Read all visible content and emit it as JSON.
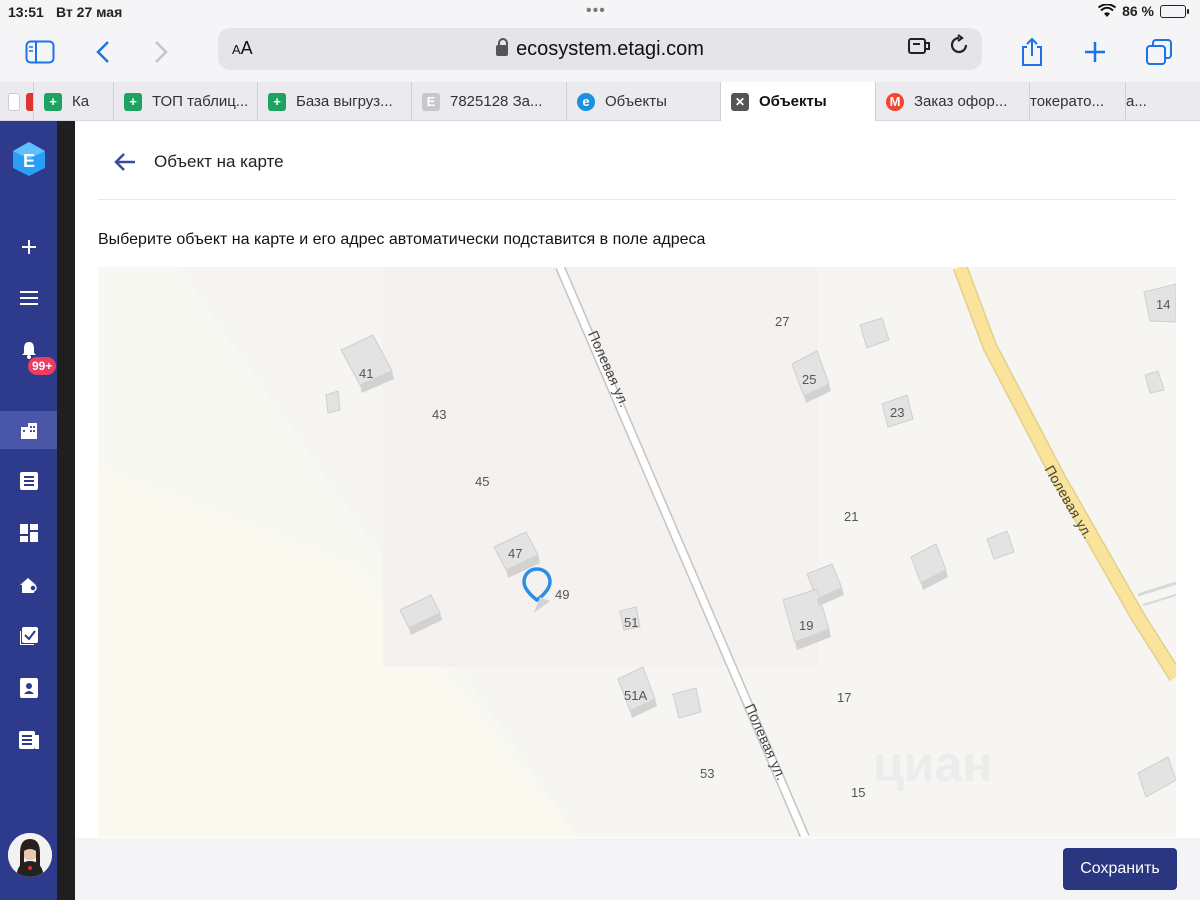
{
  "status": {
    "time": "13:51",
    "date": "Вт 27 мая",
    "battery": "86 %",
    "battery_level": 0.86
  },
  "browser": {
    "text_size": "AA",
    "url": "ecosystem.etagi.com",
    "tabs": [
      {
        "label": "Ка",
        "icon": "sheet-icon"
      },
      {
        "label": "ТОП таблиц...",
        "icon": "sheet-icon"
      },
      {
        "label": "База выгруз...",
        "icon": "sheet-icon"
      },
      {
        "label": "7825128 За...",
        "icon": "etagi-grey-icon"
      },
      {
        "label": "Объекты",
        "icon": "etagi-icon"
      },
      {
        "label": "Объекты",
        "icon": "close-icon",
        "active": true
      },
      {
        "label": "Заказ офор...",
        "icon": "yandex-icon"
      },
      {
        "label": "токерато...",
        "icon": ""
      },
      {
        "label": "а...",
        "icon": ""
      }
    ]
  },
  "sidebar": {
    "notifications_badge": "99+"
  },
  "page": {
    "title": "Объект на карте",
    "hint": "Выберите объект на карте и его адрес автоматически подставится в поле адреса",
    "save_label": "Сохранить"
  },
  "map": {
    "street_name": "Полевая ул.",
    "house_numbers": [
      "41",
      "43",
      "45",
      "47",
      "49",
      "51",
      "51А",
      "53",
      "27",
      "25",
      "23",
      "21",
      "19",
      "17",
      "15",
      "14"
    ],
    "watermark": "циан"
  }
}
